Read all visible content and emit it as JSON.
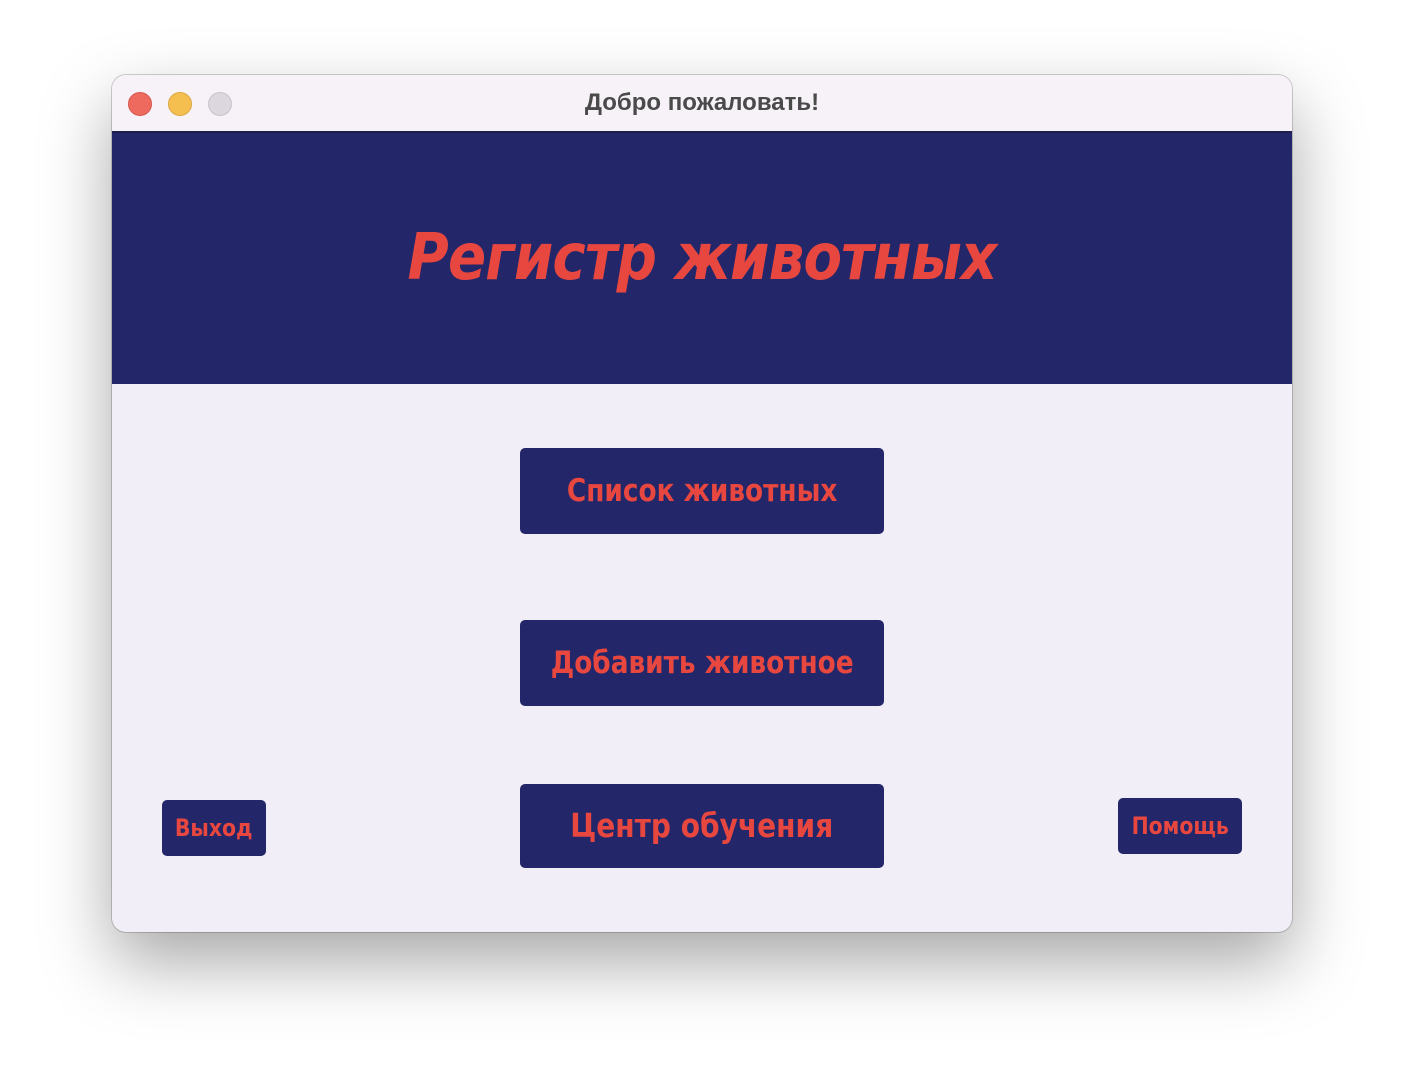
{
  "window": {
    "title": "Добро пожаловать!"
  },
  "header": {
    "title": "Регистр животных"
  },
  "menu": {
    "animal_list_label": "Список животных",
    "add_animal_label": "Добавить животное",
    "learning_center_label": "Центр обучения"
  },
  "footer": {
    "exit_label": "Выход",
    "help_label": "Помощь"
  },
  "colors": {
    "header_bg": "#23276a",
    "accent_text": "#e8473f",
    "content_bg": "#f1eef7"
  }
}
